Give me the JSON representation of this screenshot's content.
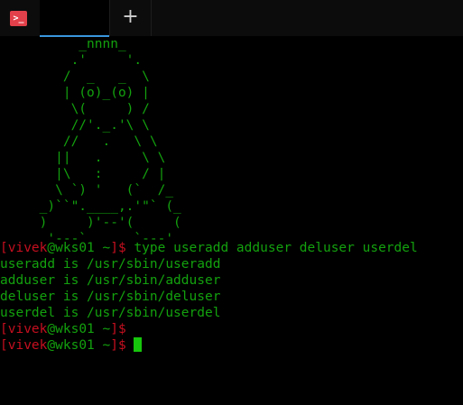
{
  "tabbar": {
    "app_icon_glyph": ">_",
    "new_tab_glyph": "+"
  },
  "colors": {
    "background": "#000000",
    "text_green": "#13a10e",
    "prompt_red": "#c50f1f",
    "cursor": "#16c60c",
    "tab_accent": "#3a96dd",
    "app_icon": "#e2404a"
  },
  "ascii_art": [
    "          _nnnn_",
    "         .'     '.",
    "        /  _   _  \\",
    "        | (o)_(o) |",
    "         \\(     ) /",
    "         //'._.'\\ \\",
    "        //   .   \\ \\",
    "       ||   .     \\ \\",
    "       |\\   :     / |",
    "       \\ `) '   (`  /_",
    "     _)``\".____,.'\"` (_",
    "     )     )'--'(     (",
    "      '---`      `---'"
  ],
  "terminal": {
    "prompt_user": "vivek",
    "prompt_at": "@",
    "prompt_host": "wks01",
    "prompt_dir": "~",
    "prompt_open": "[",
    "prompt_close": "]$",
    "command": " type useradd adduser deluser userdel",
    "output": [
      "useradd is /usr/sbin/useradd",
      "adduser is /usr/sbin/adduser",
      "deluser is /usr/sbin/deluser",
      "userdel is /usr/sbin/userdel"
    ]
  }
}
